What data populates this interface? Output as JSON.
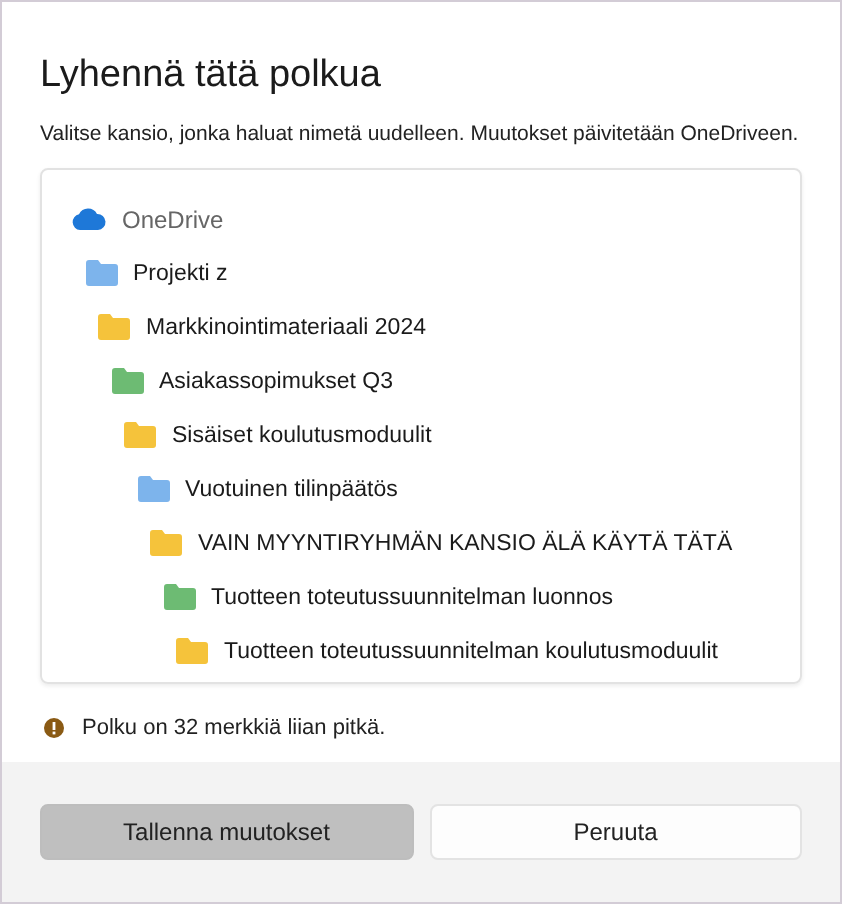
{
  "dialog": {
    "title": "Lyhennä tätä polkua",
    "description": "Valitse kansio, jonka haluat nimetä uudelleen. Muutokset päivitetään OneDriveen."
  },
  "tree": {
    "root": "OneDrive",
    "folders": [
      {
        "name": "Projekti z",
        "color": "#7db4ec",
        "children": [
          {
            "name": "Markkinointimateriaali 2024",
            "color": "#f5c33b",
            "children": [
              {
                "name": "Asiakassopimukset Q3",
                "color": "#6dbb73",
                "children": [
                  {
                    "name": "Sisäiset koulutusmoduulit",
                    "color": "#f5c33b",
                    "children": [
                      {
                        "name": "Vuotuinen tilinpäätös",
                        "color": "#7db4ec",
                        "children": [
                          {
                            "name": "VAIN MYYNTIRYHMÄN KANSIO ÄLÄ KÄYTÄ TÄTÄ",
                            "color": "#f5c33b",
                            "children": [
                              {
                                "name": "Tuotteen toteutussuunnitelman luonnos",
                                "color": "#6dbb73",
                                "children": [
                                  {
                                    "name": "Tuotteen toteutussuunnitelman koulutusmoduulit",
                                    "color": "#f5c33b"
                                  }
                                ]
                              }
                            ]
                          }
                        ]
                      }
                    ]
                  }
                ]
              }
            ]
          }
        ]
      }
    ]
  },
  "warning": "Polku on 32 merkkiä liian pitkä.",
  "buttons": [
    {
      "label": "Tallenna muutokset",
      "disabled": true
    },
    {
      "label": "Peruuta",
      "disabled": false
    }
  ]
}
